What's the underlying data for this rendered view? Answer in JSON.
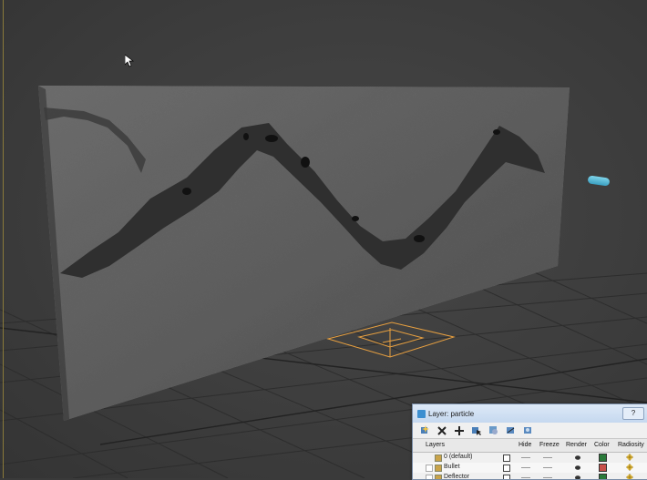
{
  "viewport": {
    "background_color": "#3e3e3e",
    "grid_color": "#2a2a2a",
    "gizmo_color": "#e8a040",
    "selected_object_color": "#5fb8d6"
  },
  "layer_dialog": {
    "title": "Layer: particle",
    "help_label": "?",
    "toolbar": [
      {
        "icon": "create-layer-icon"
      },
      {
        "icon": "delete-layer-icon"
      },
      {
        "icon": "add-selection-icon"
      },
      {
        "icon": "select-objects-icon"
      },
      {
        "icon": "highlight-layer-icon"
      },
      {
        "icon": "hide-all-icon"
      },
      {
        "icon": "freeze-all-icon"
      }
    ],
    "columns": {
      "layers": "Layers",
      "hide": "Hide",
      "freeze": "Freeze",
      "render": "Render",
      "color": "Color",
      "radiosity": "Radiosity"
    },
    "rows": [
      {
        "name": "0 (default)",
        "color": "#2a7a3a"
      },
      {
        "name": "Bullet",
        "color": "#c8504a"
      },
      {
        "name": "Deflector",
        "color": "#2a7a3a"
      }
    ]
  }
}
